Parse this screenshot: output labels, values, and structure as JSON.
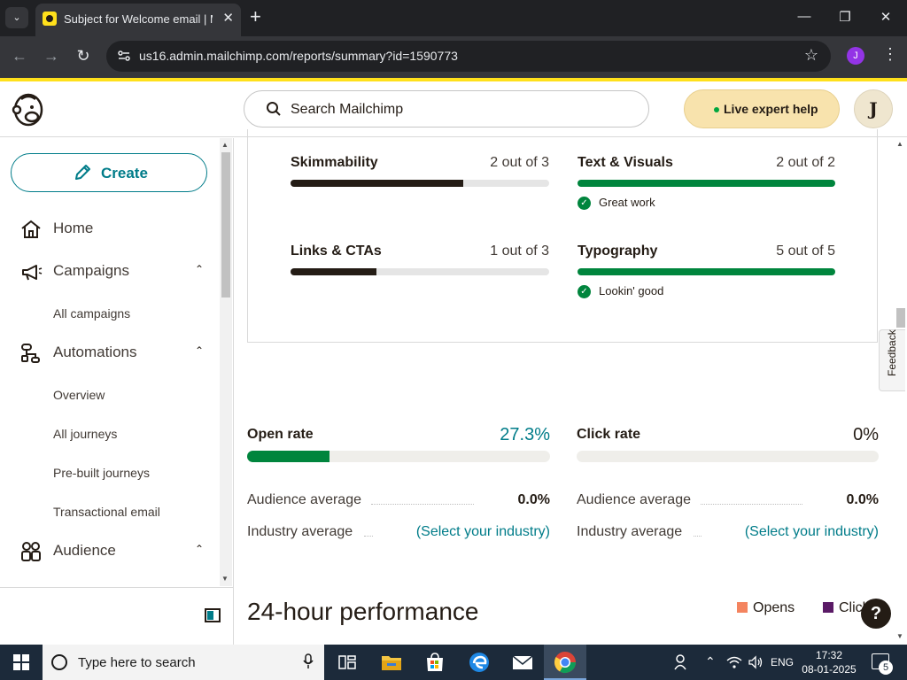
{
  "browser": {
    "tab_title": "Subject for Welcome email | Mailchimp",
    "url": "us16.admin.mailchimp.com/reports/summary?id=1590773",
    "profile_initial": "J",
    "new_tab": "+",
    "tab_close": "✕",
    "minimize": "—",
    "maximize": "❐",
    "close": "✕",
    "back": "←",
    "forward": "→",
    "reload": "↻",
    "star": "☆",
    "menu": "⋮",
    "tab_menu": "⌄"
  },
  "header": {
    "search_placeholder": "Search Mailchimp",
    "live_help_label": "Live expert help",
    "avatar_initial": "J"
  },
  "sidebar": {
    "create_label": "Create",
    "items": [
      {
        "label": "Home",
        "icon": "home-icon"
      },
      {
        "label": "Campaigns",
        "icon": "megaphone-icon",
        "chevron": "⌃"
      },
      {
        "label": "Automations",
        "icon": "automation-icon",
        "chevron": "⌃"
      },
      {
        "label": "Audience",
        "icon": "audience-icon",
        "chevron": "⌃"
      }
    ],
    "campaigns_sub": [
      "All campaigns"
    ],
    "automations_sub": [
      "Overview",
      "All journeys",
      "Pre-built journeys",
      "Transactional email"
    ]
  },
  "insights": {
    "metrics": [
      {
        "name": "Skimmability",
        "score": "2 out of 3",
        "fraction": 0.667,
        "style": "dark"
      },
      {
        "name": "Text & Visuals",
        "score": "2 out of 2",
        "fraction": 1.0,
        "style": "green",
        "note": "Great work"
      },
      {
        "name": "Links & CTAs",
        "score": "1 out of 3",
        "fraction": 0.333,
        "style": "dark"
      },
      {
        "name": "Typography",
        "score": "5 out of 5",
        "fraction": 1.0,
        "style": "green",
        "note": "Lookin' good"
      }
    ]
  },
  "feedback_label": "Feedback",
  "rates": {
    "open": {
      "label": "Open rate",
      "value": "27.3%",
      "fraction": 0.273,
      "audience_avg_label": "Audience average",
      "audience_avg": "0.0%",
      "industry_avg_label": "Industry average",
      "industry_avg": "(Select your industry)"
    },
    "click": {
      "label": "Click rate",
      "value": "0%",
      "fraction": 0.0,
      "audience_avg_label": "Audience average",
      "audience_avg": "0.0%",
      "industry_avg_label": "Industry average",
      "industry_avg": "(Select your industry)"
    }
  },
  "performance": {
    "title": "24-hour performance",
    "legend": [
      {
        "label": "Opens",
        "color": "#f4845f"
      },
      {
        "label": "Clicks",
        "color": "#5a1a66"
      }
    ]
  },
  "help_label": "?",
  "taskbar": {
    "search_placeholder": "Type here to search",
    "language": "ENG",
    "time": "17:32",
    "date": "08-01-2025",
    "notifications": "5"
  },
  "colors": {
    "accent": "#007c89",
    "brand_yellow": "#ffe01b",
    "success": "#00853d"
  }
}
